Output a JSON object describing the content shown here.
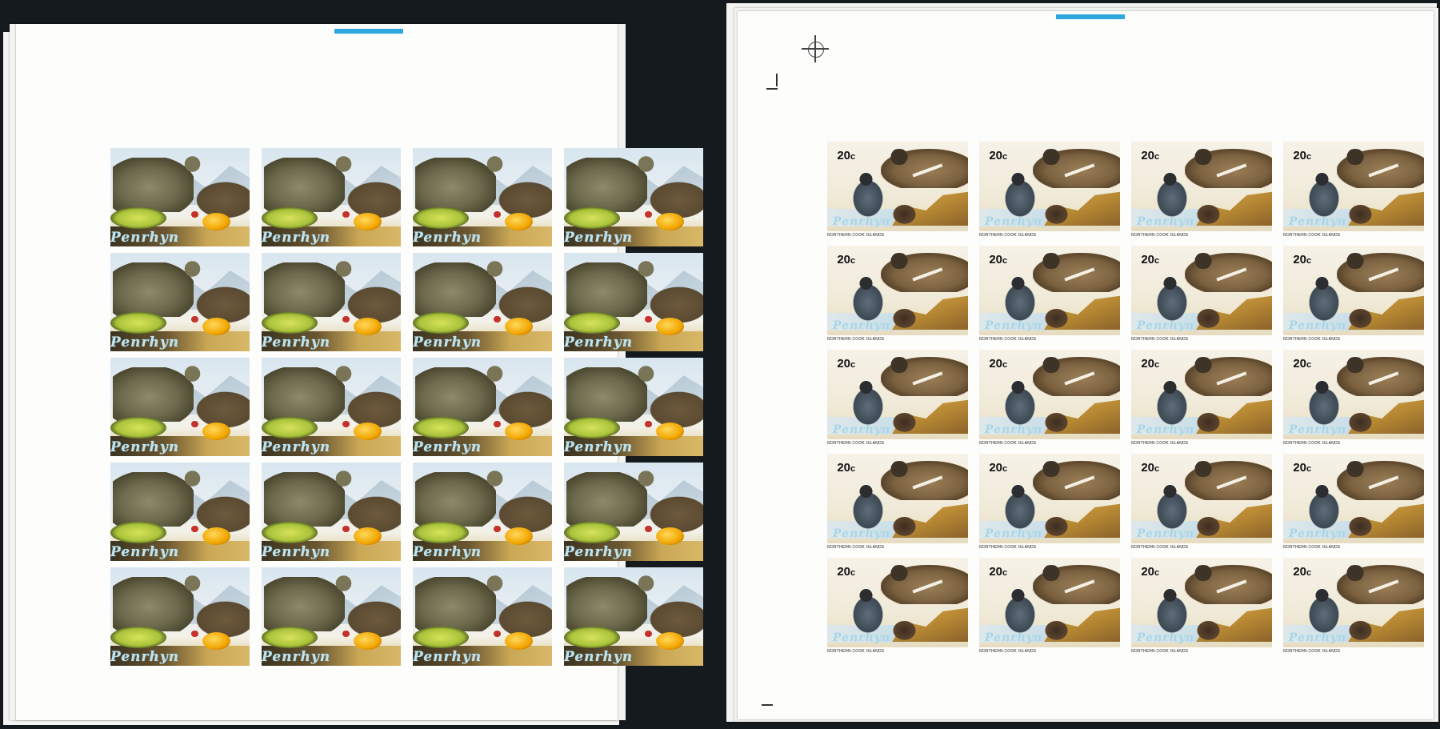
{
  "colors": {
    "background": "#151a1e",
    "sheet": "#fdfdfc",
    "margin_strip": "#2ea6de"
  },
  "left_sheet": {
    "rows": 5,
    "columns": 4,
    "stamp_script": "Penrhyn"
  },
  "right_sheet": {
    "rows": 5,
    "columns": 4,
    "denomination": "20",
    "denomination_unit": "c",
    "country_caption": "NORTHERN COOK ISLANDS",
    "stamp_script": "Penrhyn"
  }
}
